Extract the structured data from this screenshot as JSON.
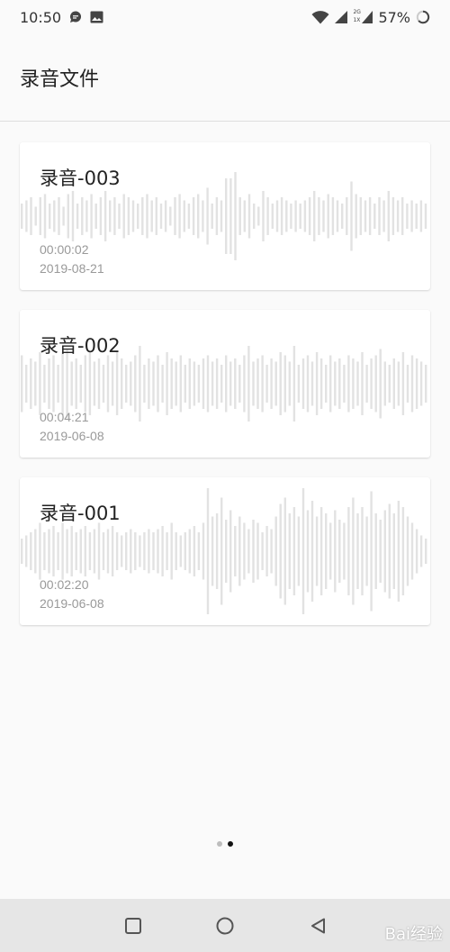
{
  "status_bar": {
    "time": "10:50",
    "icons_left": [
      "chat-bubble-icon",
      "image-icon"
    ],
    "network_label_top": "2G",
    "network_label_bottom": "1X",
    "battery": "57%"
  },
  "app_bar": {
    "title": "录音文件"
  },
  "recordings": [
    {
      "title": "录音-003",
      "duration": "00:00:02",
      "date": "2019-08-21",
      "waveform": [
        0.2,
        0.25,
        0.3,
        0.15,
        0.3,
        0.35,
        0.2,
        0.25,
        0.3,
        0.15,
        0.35,
        0.4,
        0.2,
        0.3,
        0.25,
        0.35,
        0.2,
        0.3,
        0.4,
        0.25,
        0.3,
        0.2,
        0.35,
        0.3,
        0.25,
        0.2,
        0.3,
        0.35,
        0.25,
        0.3,
        0.2,
        0.25,
        0.15,
        0.3,
        0.35,
        0.25,
        0.2,
        0.3,
        0.35,
        0.25,
        0.45,
        0.2,
        0.3,
        0.25,
        0.6,
        0.6,
        0.7,
        0.3,
        0.25,
        0.35,
        0.2,
        0.15,
        0.4,
        0.3,
        0.2,
        0.25,
        0.3,
        0.25,
        0.2,
        0.25,
        0.2,
        0.25,
        0.3,
        0.4,
        0.3,
        0.25,
        0.35,
        0.3,
        0.25,
        0.2,
        0.3,
        0.55,
        0.35,
        0.3,
        0.25,
        0.3,
        0.2,
        0.3,
        0.25,
        0.4,
        0.3,
        0.25,
        0.3,
        0.2,
        0.25,
        0.2,
        0.25,
        0.2
      ]
    },
    {
      "title": "录音-002",
      "duration": "00:04:21",
      "date": "2019-06-08",
      "waveform": [
        0.45,
        0.3,
        0.4,
        0.35,
        0.5,
        0.3,
        0.4,
        0.45,
        0.3,
        0.5,
        0.55,
        0.35,
        0.4,
        0.3,
        0.45,
        0.5,
        0.35,
        0.4,
        0.3,
        0.45,
        0.35,
        0.5,
        0.4,
        0.3,
        0.35,
        0.45,
        0.6,
        0.3,
        0.4,
        0.35,
        0.45,
        0.3,
        0.5,
        0.4,
        0.35,
        0.45,
        0.3,
        0.4,
        0.35,
        0.3,
        0.4,
        0.45,
        0.35,
        0.4,
        0.3,
        0.45,
        0.35,
        0.4,
        0.3,
        0.45,
        0.6,
        0.35,
        0.4,
        0.45,
        0.3,
        0.4,
        0.35,
        0.5,
        0.45,
        0.35,
        0.6,
        0.3,
        0.4,
        0.45,
        0.35,
        0.5,
        0.4,
        0.3,
        0.45,
        0.35,
        0.4,
        0.3,
        0.45,
        0.4,
        0.35,
        0.5,
        0.3,
        0.4,
        0.45,
        0.55,
        0.35,
        0.3,
        0.4,
        0.35,
        0.5,
        0.3,
        0.45,
        0.4,
        0.35,
        0.3
      ]
    },
    {
      "title": "录音-001",
      "duration": "00:02:20",
      "date": "2019-06-08",
      "waveform": [
        0.2,
        0.25,
        0.3,
        0.35,
        0.45,
        0.3,
        0.35,
        0.4,
        0.3,
        0.45,
        0.35,
        0.4,
        0.3,
        0.35,
        0.4,
        0.3,
        0.35,
        0.45,
        0.3,
        0.35,
        0.4,
        0.3,
        0.25,
        0.3,
        0.35,
        0.3,
        0.25,
        0.3,
        0.35,
        0.3,
        0.35,
        0.4,
        0.3,
        0.45,
        0.3,
        0.25,
        0.3,
        0.35,
        0.4,
        0.3,
        0.45,
        1.0,
        0.55,
        0.6,
        0.85,
        0.5,
        0.65,
        0.4,
        0.55,
        0.45,
        0.35,
        0.5,
        0.45,
        0.3,
        0.4,
        0.35,
        0.55,
        0.75,
        0.85,
        0.6,
        0.7,
        0.55,
        1.0,
        0.65,
        0.8,
        0.55,
        0.7,
        0.6,
        0.45,
        0.65,
        0.5,
        0.45,
        0.7,
        0.85,
        0.6,
        0.7,
        0.55,
        0.95,
        0.6,
        0.5,
        0.65,
        0.75,
        0.6,
        0.8,
        0.7,
        0.55,
        0.45,
        0.35,
        0.25,
        0.2
      ]
    }
  ],
  "page_indicator": {
    "count": 2,
    "active_index": 1
  },
  "nav_bar": {
    "buttons": [
      "recents-square-icon",
      "home-circle-icon",
      "back-triangle-icon"
    ]
  },
  "watermark": "Bai经验"
}
